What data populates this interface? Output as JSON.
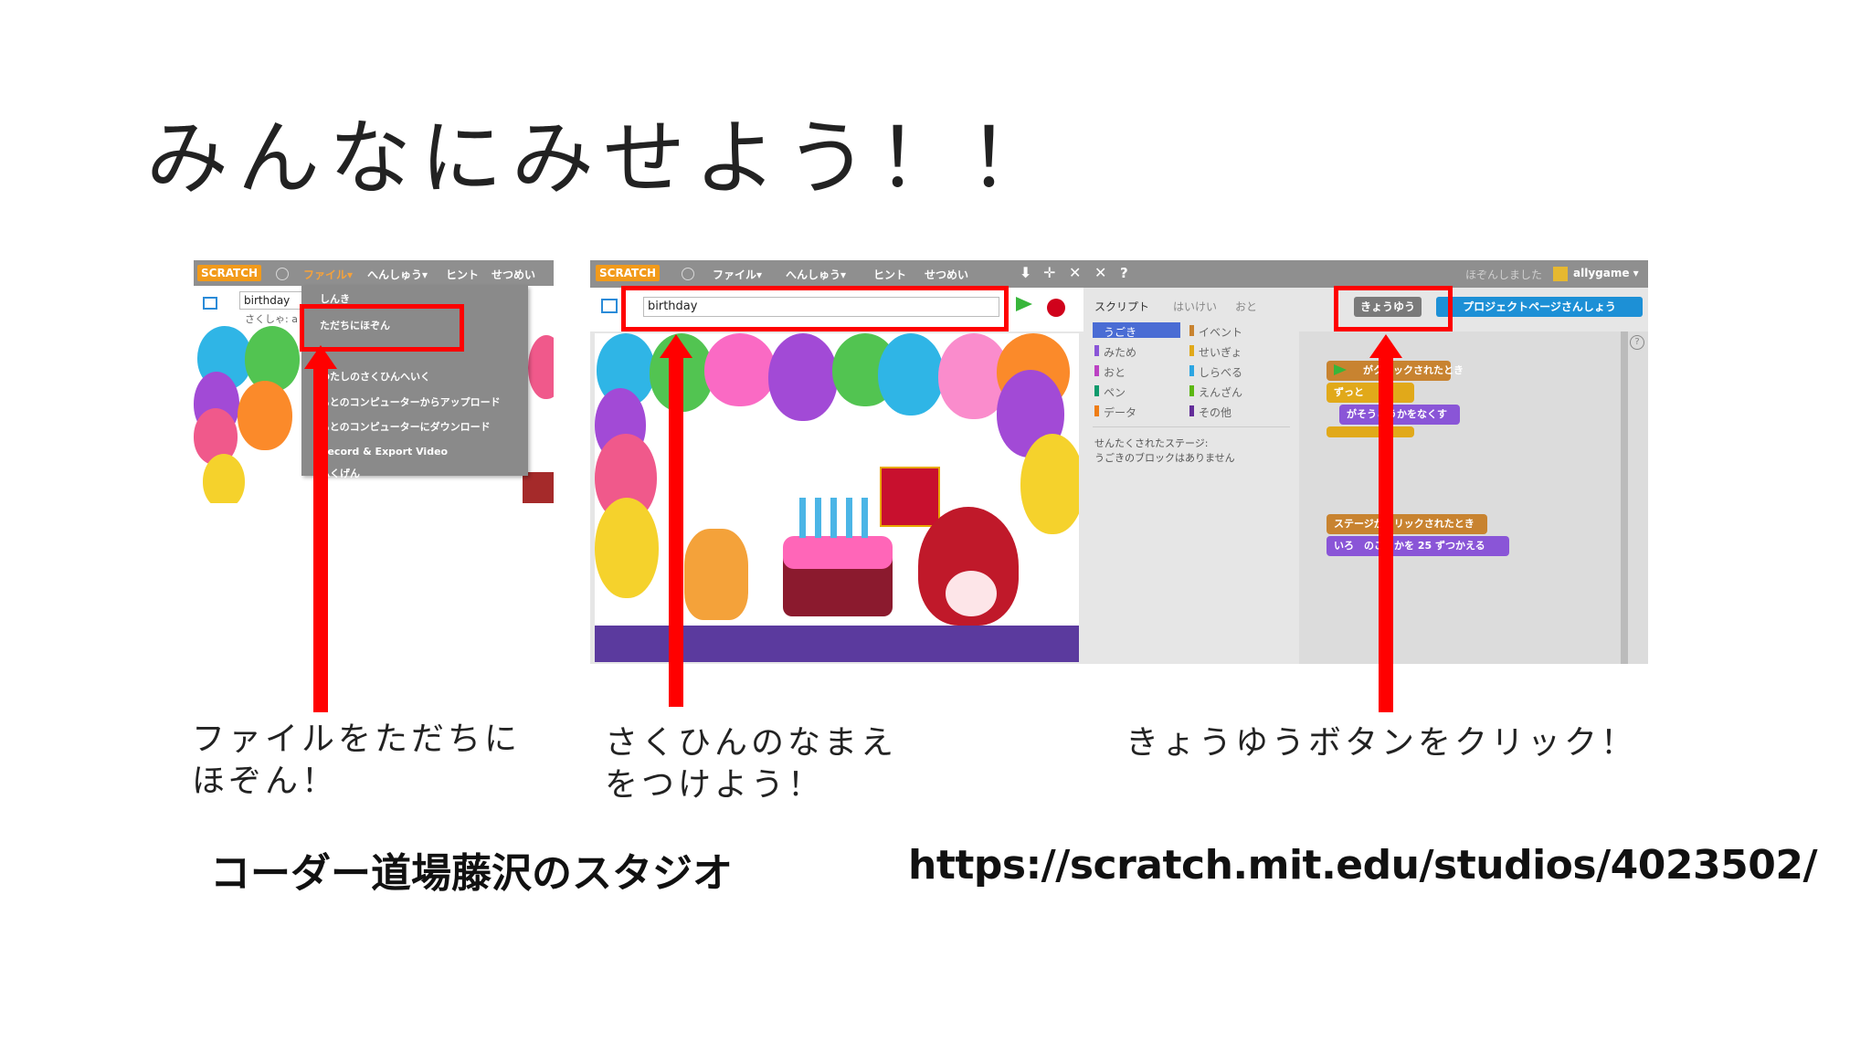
{
  "slide": {
    "title": "みんなにみせよう！！",
    "caption_left_line1": "ファイルをただちに",
    "caption_left_line2": "ほぞん！",
    "caption_mid_line1": "さくひんのなまえ",
    "caption_mid_line2": "をつけよう！",
    "caption_right": "きょうゆうボタンをクリック！",
    "footer_studio": "コーダー道場藤沢のスタジオ",
    "footer_url": "https://scratch.mit.edu/studios/4023502/"
  },
  "left_shot": {
    "logo": "SCRATCH",
    "menu": [
      "ファイル▾",
      "へんしゅう▾",
      "ヒント",
      "せつめい"
    ],
    "project_name": "birthday",
    "author": "さくしゃ: a",
    "file_menu": [
      "しんき",
      "ただちにほぞん",
      "",
      "わたしのさくひんへいく",
      "もとのコンピューターからアップロード",
      "もとのコンピューターにダウンロード",
      "Record & Export Video",
      "ふくげん"
    ]
  },
  "right_shot": {
    "logo": "SCRATCH",
    "menu": [
      "ファイル▾",
      "へんしゅう▾",
      "ヒント",
      "せつめい"
    ],
    "project_name": "birthday",
    "saved_text": "ほぞんしました",
    "username": "allygame ▾",
    "tabs": [
      "スクリプト",
      "はいけい",
      "おと"
    ],
    "categories_left": [
      "うごき",
      "みため",
      "おと",
      "ペン",
      "データ"
    ],
    "categories_right": [
      "イベント",
      "せいぎょ",
      "しらべる",
      "えんざん",
      "その他"
    ],
    "selected_stage_line1": "せんたくされたステージ:",
    "selected_stage_line2": "うごきのブロックはありません",
    "share_button": "きょうゆう",
    "project_page_button": "プロジェクトページさんしょう",
    "blocks": {
      "when_flag": "がクリックされたとき",
      "forever": "ずっと",
      "effect": "がそうこうかをなくす",
      "when_stage": "ステージがクリックされたとき",
      "change": "いろ　のこうかを 25 ずつかえる"
    }
  },
  "colors": {
    "highlight_red": "#ff0000",
    "menubar_gray": "#8f8f8f",
    "stage_floor": "#5b3a9e",
    "share_blue": "#1d90d6"
  }
}
